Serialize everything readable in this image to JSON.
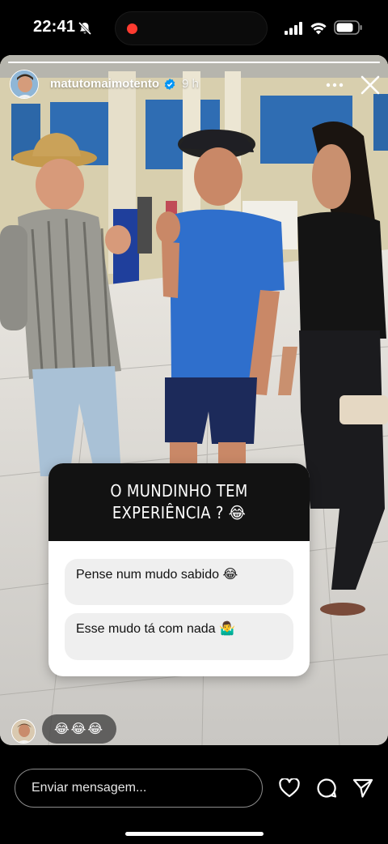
{
  "status_bar": {
    "time": "22:41"
  },
  "story": {
    "progress": 1.0,
    "username": "matutomaimotento",
    "time_ago": "9 h"
  },
  "sticker": {
    "question": "O MUNDINHO TEM EXPERIÊNCIA ? 😂",
    "answers": [
      {
        "label": "Pense num mudo sabido 😂"
      },
      {
        "label": "Esse mudo tá com nada 🤷‍♂️"
      }
    ]
  },
  "reaction": {
    "emojis": "😂😂😂"
  },
  "bottom_bar": {
    "message_placeholder": "Enviar mensagem..."
  },
  "colors": {
    "accent_live": "#ff3b30",
    "verified": "#0095f6",
    "sticker_head": "#121212"
  },
  "icons": [
    "mute-icon",
    "signal-icon",
    "wifi-icon",
    "battery-icon",
    "verified-icon",
    "more-icon",
    "close-icon",
    "heart-icon",
    "comment-icon",
    "send-icon"
  ]
}
